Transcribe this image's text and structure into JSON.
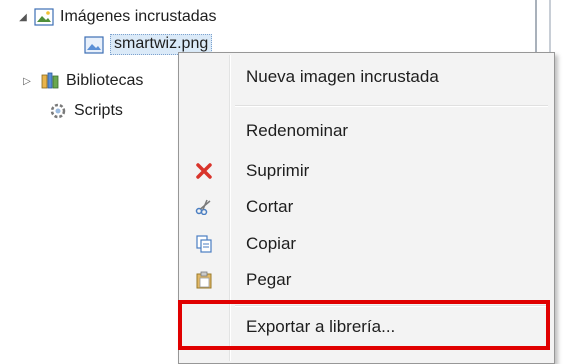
{
  "tree": {
    "embedded_images": {
      "label": "Imágenes incrustadas",
      "expander": "◢"
    },
    "selected_file": {
      "label": "smartwiz.png"
    },
    "libraries": {
      "label": "Bibliotecas",
      "expander": "▷"
    },
    "scripts": {
      "label": "Scripts"
    }
  },
  "context_menu": {
    "items": [
      {
        "label": "Nueva imagen incrustada",
        "icon": "none"
      },
      {
        "label": "Redenominar",
        "icon": "none"
      },
      {
        "label": "Suprimir",
        "icon": "delete-x-icon"
      },
      {
        "label": "Cortar",
        "icon": "scissors-icon"
      },
      {
        "label": "Copiar",
        "icon": "copy-icon"
      },
      {
        "label": "Pegar",
        "icon": "clipboard-icon"
      },
      {
        "label": "Exportar a librería...",
        "icon": "none"
      }
    ]
  },
  "colors": {
    "highlight_box": "#e00000",
    "menu_background": "#f3f3f3",
    "delete_icon": "#d9342b"
  }
}
